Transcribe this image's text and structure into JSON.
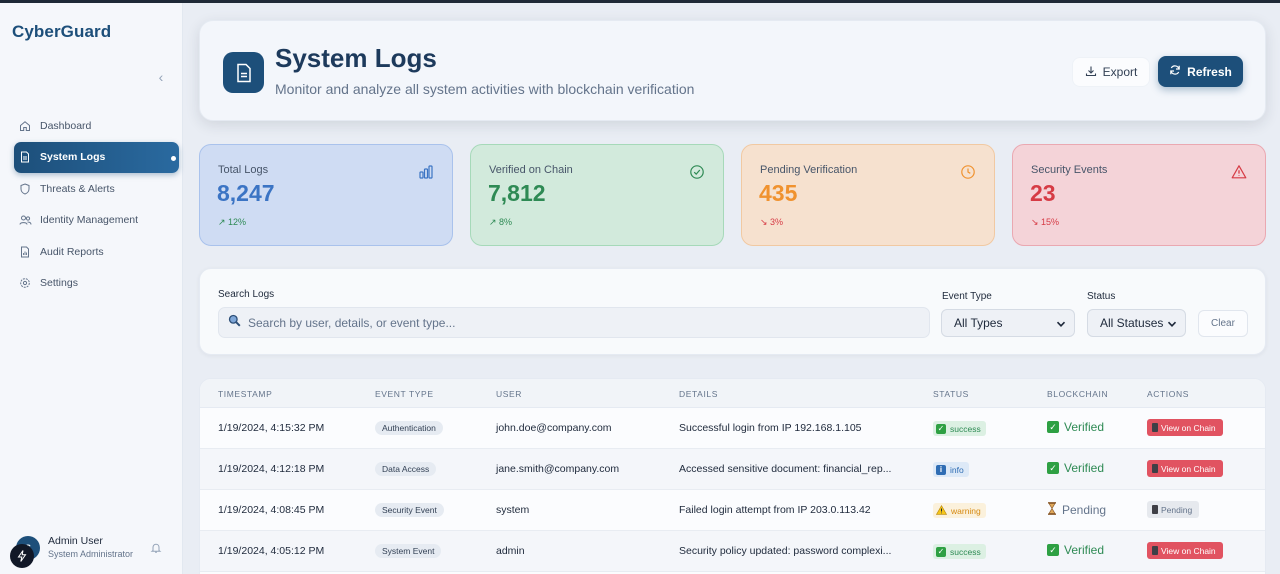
{
  "app": {
    "brand": "CyberGuard"
  },
  "sidebar": {
    "collapse_icon": "chevron-left-icon",
    "items": [
      {
        "label": "Dashboard",
        "icon": "home-icon",
        "active": false
      },
      {
        "label": "System Logs",
        "icon": "document-icon",
        "active": true
      },
      {
        "label": "Threats & Alerts",
        "icon": "shield-icon",
        "active": false
      },
      {
        "label": "Identity Management",
        "icon": "users-icon",
        "active": false
      },
      {
        "label": "Audit Reports",
        "icon": "report-icon",
        "active": false
      },
      {
        "label": "Settings",
        "icon": "gear-icon",
        "active": false
      }
    ],
    "user": {
      "initial": "S",
      "name": "Admin User",
      "role": "System Administrator"
    }
  },
  "header": {
    "title": "System Logs",
    "subtitle": "Monitor and analyze all system activities with blockchain verification",
    "export_label": "Export",
    "refresh_label": "Refresh"
  },
  "stats": [
    {
      "label": "Total Logs",
      "value": "8,247",
      "delta": "↗ 12%",
      "trend": "up",
      "icon": "bar-chart-icon",
      "color": "#3b74c4"
    },
    {
      "label": "Verified on Chain",
      "value": "7,812",
      "delta": "↗ 8%",
      "trend": "up",
      "icon": "check-circle-icon",
      "color": "#2e8a54"
    },
    {
      "label": "Pending Verification",
      "value": "435",
      "delta": "↘ 3%",
      "trend": "down",
      "icon": "clock-icon",
      "color": "#f0922f"
    },
    {
      "label": "Security Events",
      "value": "23",
      "delta": "↘ 15%",
      "trend": "down",
      "icon": "warning-icon",
      "color": "#d63b45"
    }
  ],
  "filters": {
    "search_label": "Search Logs",
    "search_placeholder": "Search by user, details, or event type...",
    "event_type_label": "Event Type",
    "event_type_value": "All Types",
    "status_label": "Status",
    "status_value": "All Statuses",
    "clear_label": "Clear"
  },
  "table": {
    "columns": [
      "Timestamp",
      "Event Type",
      "User",
      "Details",
      "Status",
      "Blockchain",
      "Actions"
    ],
    "rows": [
      {
        "timestamp": "1/19/2024, 4:15:32 PM",
        "event_type": "Authentication",
        "user": "john.doe@company.com",
        "details": "Successful login from IP 192.168.1.105",
        "status": "success",
        "blockchain": "Verified",
        "action": "View on Chain"
      },
      {
        "timestamp": "1/19/2024, 4:12:18 PM",
        "event_type": "Data Access",
        "user": "jane.smith@company.com",
        "details": "Accessed sensitive document: financial_rep...",
        "status": "info",
        "blockchain": "Verified",
        "action": "View on Chain"
      },
      {
        "timestamp": "1/19/2024, 4:08:45 PM",
        "event_type": "Security Event",
        "user": "system",
        "details": "Failed login attempt from IP 203.0.113.42",
        "status": "warning",
        "blockchain": "Pending",
        "action": "Pending"
      },
      {
        "timestamp": "1/19/2024, 4:05:12 PM",
        "event_type": "System Event",
        "user": "admin",
        "details": "Security policy updated: password complexi...",
        "status": "success",
        "blockchain": "Verified",
        "action": "View on Chain"
      }
    ]
  }
}
